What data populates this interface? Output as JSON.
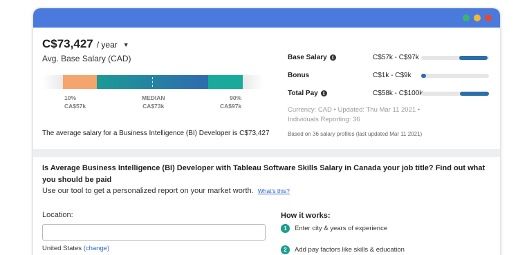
{
  "colors": {
    "titlebar": "#4a7bdc",
    "dot_green": "#3bb56b",
    "dot_yellow": "#f5b82e",
    "dot_red": "#e4473c",
    "accent_teal": "#19aa9b",
    "accent_blue": "#2f6bb0",
    "low_orange": "#f4a46c",
    "link": "#2a66c4"
  },
  "summary": {
    "salary": "C$73,427",
    "period": "/ year",
    "subtitle": "Avg. Base Salary (CAD)"
  },
  "range": {
    "low_pct": "10%",
    "low_value": "CA$57k",
    "median_label": "MEDIAN",
    "median_value": "CA$73k",
    "high_pct": "90%",
    "high_value": "CA$97k"
  },
  "avg_text": "The average salary for a Business Intelligence (BI) Developer is C$73,427",
  "stats": [
    {
      "label": "Base Salary",
      "has_info": true,
      "range": "C$57k - C$97k",
      "bar_start": 0.56,
      "bar_end": 0.98,
      "bar_color": "#2a6fa8"
    },
    {
      "label": "Bonus",
      "has_info": false,
      "range": "C$1k - C$9k",
      "bar_start": 0.0,
      "bar_end": 0.07,
      "bar_color": "#2a6fa8"
    },
    {
      "label": "Total Pay",
      "has_info": true,
      "range": "C$58k - C$100k",
      "bar_start": 0.57,
      "bar_end": 1.0,
      "bar_color": "#2a6fa8"
    }
  ],
  "meta": {
    "line1": "Currency: CAD • Updated: Thu Mar 11 2021 •",
    "line2": "Individuals Reporting: 36",
    "based_on": "Based on 36 salary profiles (last updated Mar 11 2021)"
  },
  "cta": {
    "question": "Is Average Business Intelligence (BI) Developer with Tableau Software Skills Salary in Canada your job title? Find out what you should be paid",
    "tool_line": "Use our tool to get a personalized report on your market worth.",
    "whats_this": "What's this?",
    "location_label": "Location:",
    "location_value": "",
    "country": "United States",
    "change": "(change)"
  },
  "how": {
    "title": "How it works:",
    "steps": [
      {
        "num": "1",
        "text": "Enter city & years of experience"
      },
      {
        "num": "2",
        "text": "Add pay factors like skills & education"
      }
    ]
  }
}
